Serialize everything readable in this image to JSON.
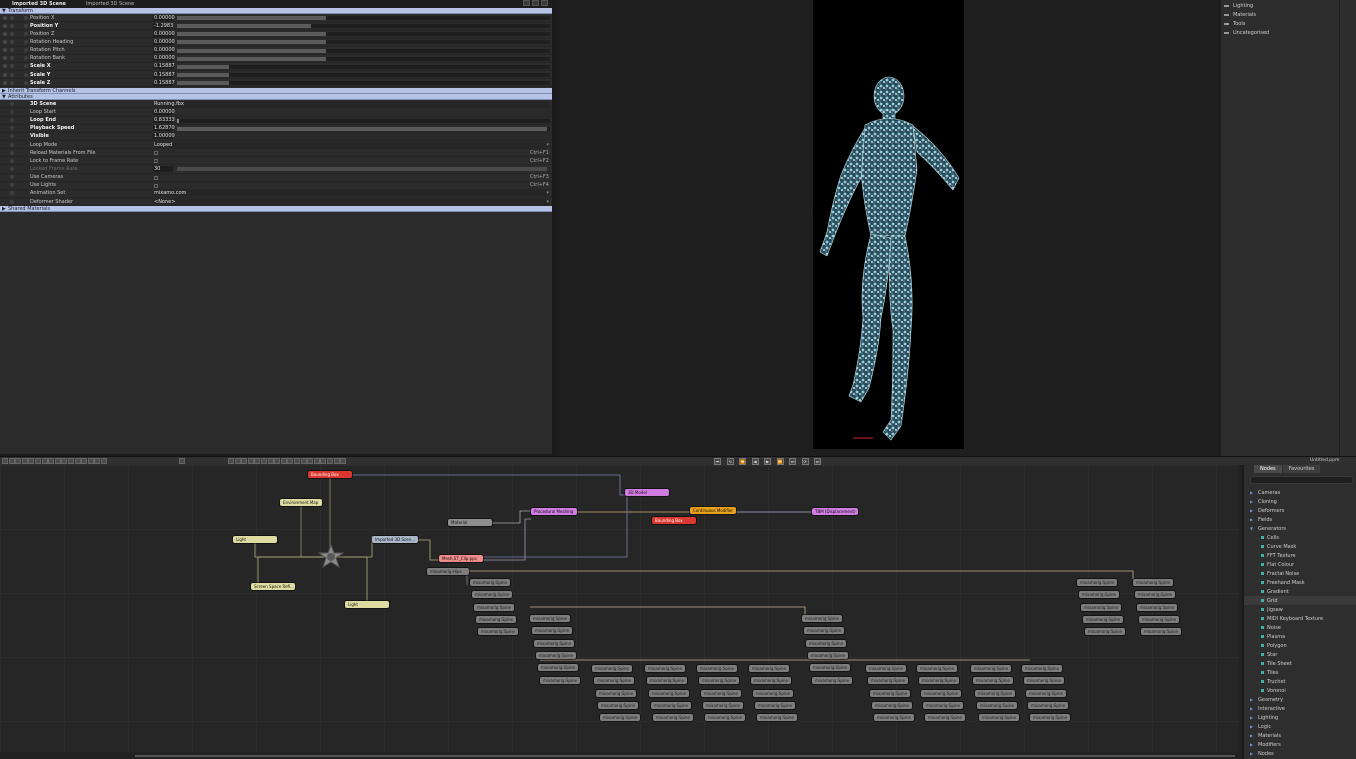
{
  "properties": {
    "title": "Imported 3D Scene",
    "subtitle": "Imported 3D Scene",
    "transform": {
      "label": "Transform",
      "rows": [
        {
          "label": "Position X",
          "value": "0.00000",
          "bar": 0.4,
          "bold": false
        },
        {
          "label": "Position Y",
          "value": "-1.2983",
          "bar": 0.36,
          "bold": true
        },
        {
          "label": "Position Z",
          "value": "0.00000",
          "bar": 0.4,
          "bold": false
        },
        {
          "label": "Rotation Heading",
          "value": "0.00000",
          "bar": 0.4,
          "bold": false
        },
        {
          "label": "Rotation Pitch",
          "value": "0.00000",
          "bar": 0.4,
          "bold": false
        },
        {
          "label": "Rotation Bank",
          "value": "0.00000",
          "bar": 0.4,
          "bold": false
        },
        {
          "label": "Scale X",
          "value": "0.15887",
          "bar": 0.14,
          "bold": true
        },
        {
          "label": "Scale Y",
          "value": "0.15887",
          "bar": 0.14,
          "bold": true
        },
        {
          "label": "Scale Z",
          "value": "0.15887",
          "bar": 0.14,
          "bold": true
        }
      ]
    },
    "inherit": {
      "label": "Inherit Transform Channels"
    },
    "attributes": {
      "label": "Attributes",
      "rows": [
        {
          "label": "3D Scene",
          "value": "Running.fbx",
          "kind": "text",
          "bold": true
        },
        {
          "label": "Loop Start",
          "value": "0.00000",
          "kind": "num",
          "bold": false
        },
        {
          "label": "Loop End",
          "value": "0.83333",
          "kind": "num",
          "bold": true
        },
        {
          "label": "Playback Speed",
          "value": "1.62870",
          "kind": "bar",
          "bold": true
        },
        {
          "label": "Visible",
          "value": "1.00000",
          "kind": "num",
          "bold": true
        },
        {
          "label": "Loop Mode",
          "value": "Looped",
          "kind": "dd",
          "bold": false
        },
        {
          "label": "Reload Materials From File",
          "value": "",
          "kind": "chk",
          "shortcut": "Ctrl+F1",
          "bold": false
        },
        {
          "label": "Lock to Frame Rate",
          "value": "",
          "kind": "chk",
          "shortcut": "Ctrl+F2",
          "bold": false
        },
        {
          "label": "Locked Frame Rate",
          "value": "30",
          "kind": "track",
          "dim": true,
          "bold": false
        },
        {
          "label": "Use Cameras",
          "value": "",
          "kind": "chk",
          "shortcut": "Ctrl+F3",
          "bold": false
        },
        {
          "label": "Use Lights",
          "value": "",
          "kind": "chk",
          "shortcut": "Ctrl+F4",
          "bold": false
        },
        {
          "label": "Animation Set",
          "value": "mixamo.com",
          "kind": "dd",
          "bold": false
        },
        {
          "label": "Deformer Shader",
          "value": "<None>",
          "kind": "dd",
          "bold": false
        }
      ]
    },
    "shared": {
      "label": "Shared Materials"
    }
  },
  "right_list": [
    "Lighting",
    "Materials",
    "Tools",
    "Uncategorised"
  ],
  "graph": {
    "nodes": [
      {
        "label": "Bounding Box",
        "color": "red"
      },
      {
        "label": "Environment Map",
        "color": "yel"
      },
      {
        "label": "Light",
        "color": "yel"
      },
      {
        "label": "Screen Space Refl...",
        "color": "yel"
      },
      {
        "label": "Light",
        "color": "yel"
      },
      {
        "label": "Imported 3D Scen...",
        "color": "blu"
      },
      {
        "label": "Material",
        "color": "gry"
      },
      {
        "label": "Mesh,ST_Clip.pps",
        "color": "pnk"
      },
      {
        "label": "Procedural Meshing",
        "color": "pur"
      },
      {
        "label": "3D Model",
        "color": "pur"
      },
      {
        "label": "Continuous Modifier",
        "color": "org"
      },
      {
        "label": "Bounding Box",
        "color": "red"
      },
      {
        "label": "TBM (Displacement)",
        "color": "pur"
      }
    ],
    "group_label": "mixamorig:Hips",
    "bone_label": "mixamorig:Spine",
    "bone_count": 78
  },
  "node_library": {
    "tabs": [
      "Nodes",
      "Favourites"
    ],
    "categories": [
      {
        "label": "Cameras",
        "sub": false
      },
      {
        "label": "Cloning",
        "sub": false
      },
      {
        "label": "Deformers",
        "sub": false
      },
      {
        "label": "Fields",
        "sub": false
      },
      {
        "label": "Generators",
        "sub": false,
        "open": true
      },
      {
        "label": "Cells",
        "sub": true
      },
      {
        "label": "Curve Mask",
        "sub": true
      },
      {
        "label": "FFT Texture",
        "sub": true
      },
      {
        "label": "Flat Colour",
        "sub": true
      },
      {
        "label": "Fractal Noise",
        "sub": true
      },
      {
        "label": "Freehand Mask",
        "sub": true
      },
      {
        "label": "Gradient",
        "sub": true
      },
      {
        "label": "Grid",
        "sub": true,
        "sel": true
      },
      {
        "label": "Jigsaw",
        "sub": true
      },
      {
        "label": "MIDI Keyboard Texture",
        "sub": true
      },
      {
        "label": "Noise",
        "sub": true
      },
      {
        "label": "Plasma",
        "sub": true
      },
      {
        "label": "Polygon",
        "sub": true
      },
      {
        "label": "Star",
        "sub": true
      },
      {
        "label": "Tile Sheet",
        "sub": true
      },
      {
        "label": "Tiles",
        "sub": true
      },
      {
        "label": "Truchet",
        "sub": true
      },
      {
        "label": "Voronoi",
        "sub": true
      },
      {
        "label": "Geometry",
        "sub": false
      },
      {
        "label": "Interactive",
        "sub": false
      },
      {
        "label": "Lighting",
        "sub": false
      },
      {
        "label": "Logic",
        "sub": false
      },
      {
        "label": "Materials",
        "sub": false
      },
      {
        "label": "Modifiers",
        "sub": false
      },
      {
        "label": "Nodes",
        "sub": false
      }
    ]
  },
  "file_name": "Untitled.ppm",
  "colors": {
    "accent": "#b6c3e6",
    "render_bg": "#000000",
    "hologram": "#8fd6e8"
  }
}
